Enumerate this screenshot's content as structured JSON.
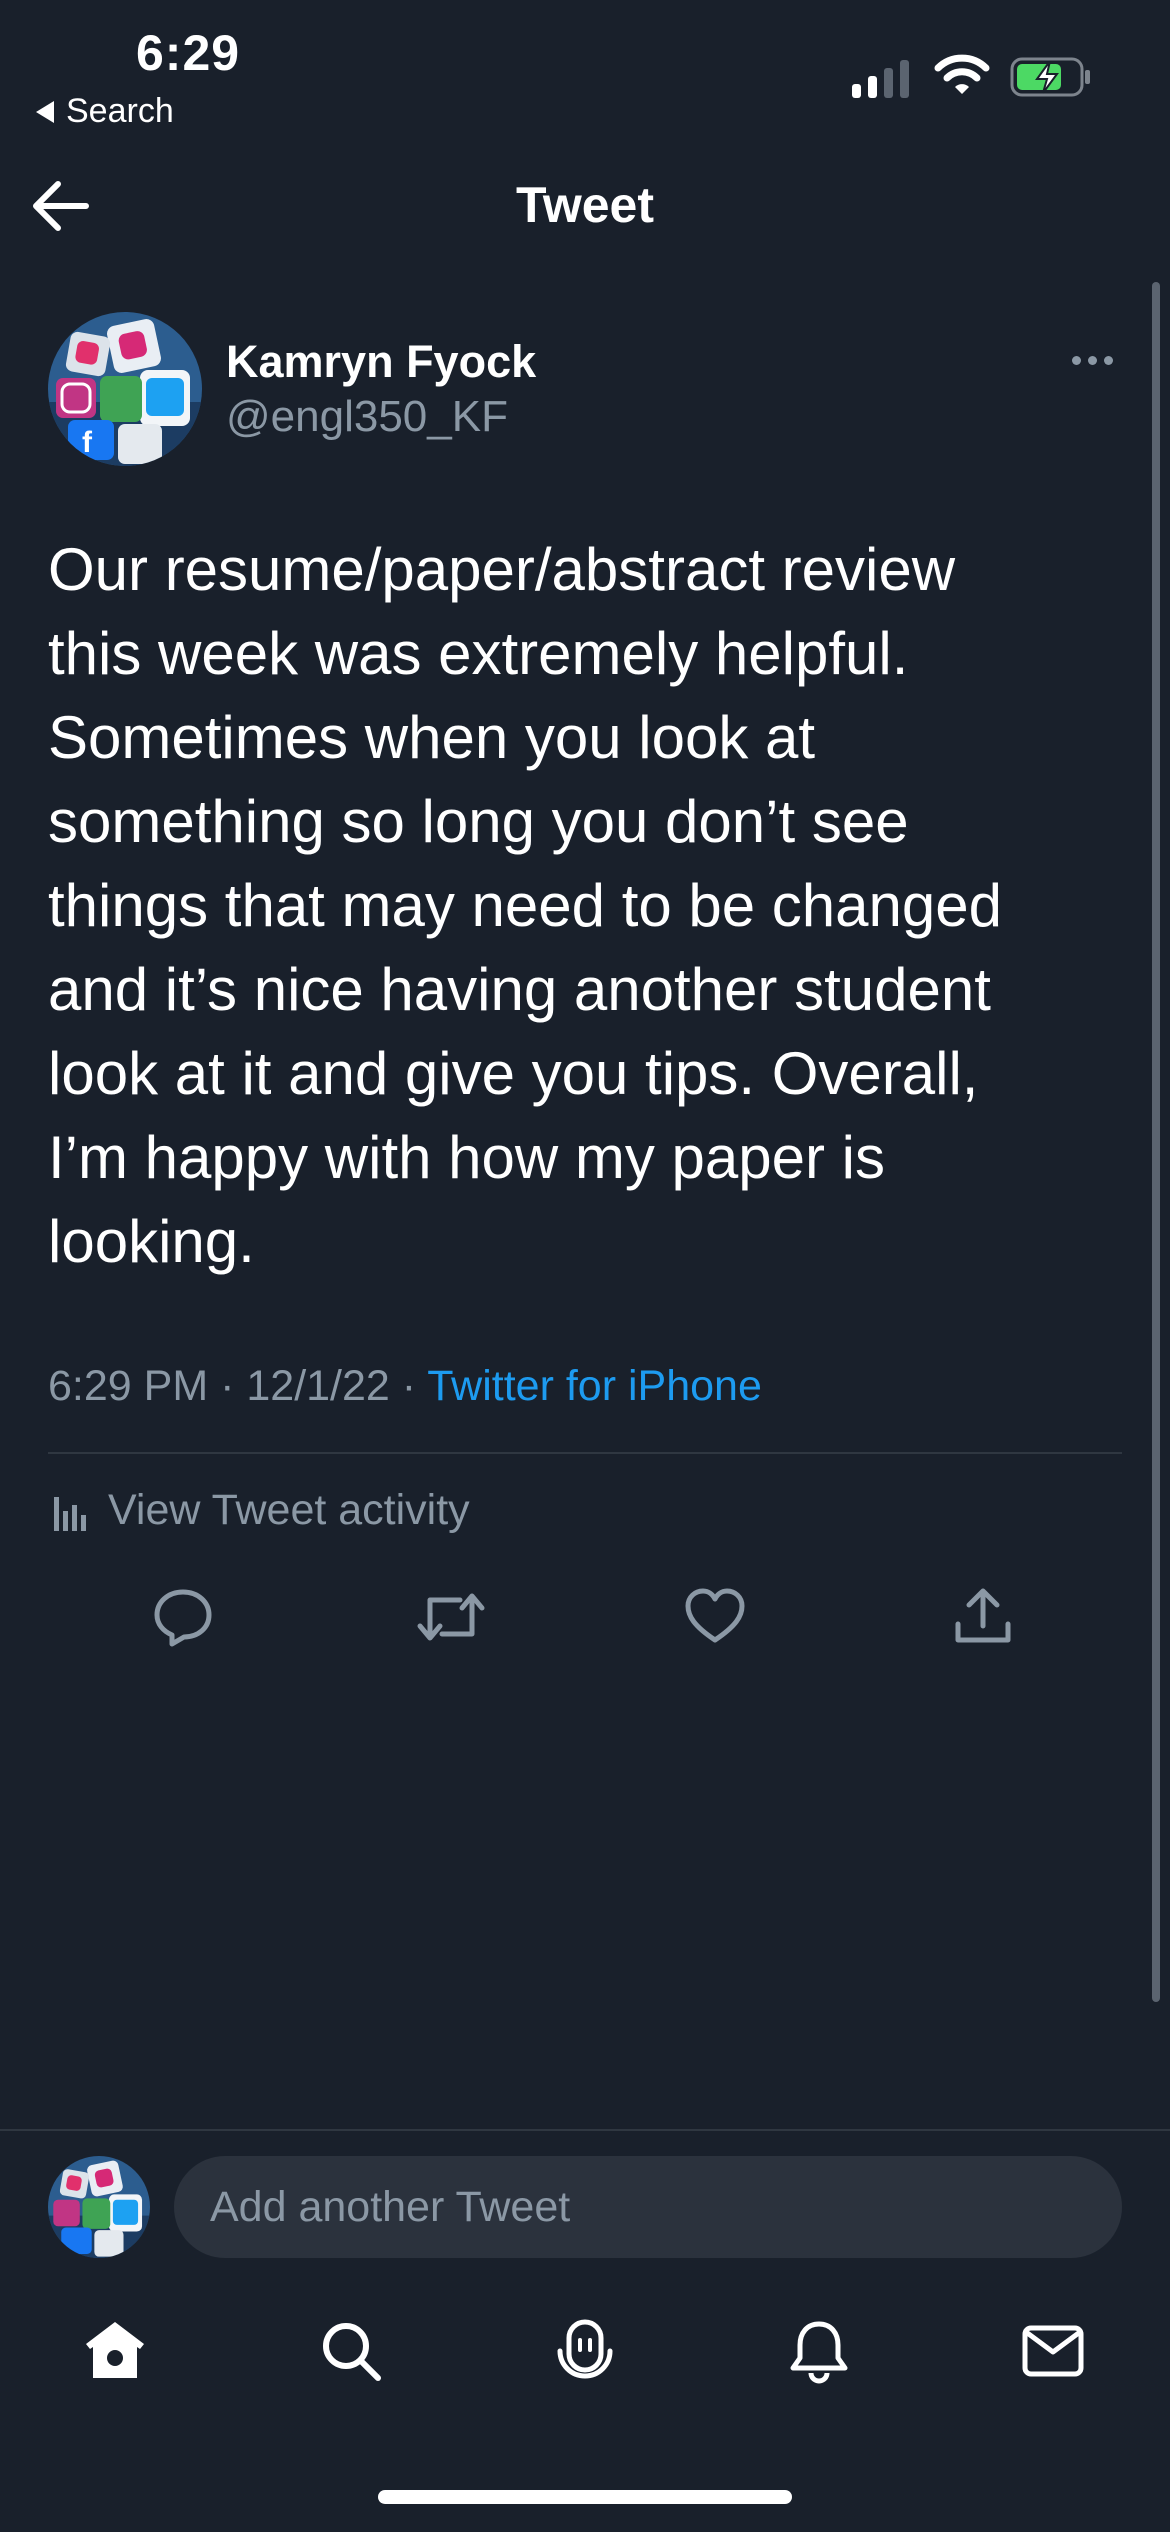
{
  "status_bar": {
    "time": "6:29",
    "back_label": "Search"
  },
  "header": {
    "title": "Tweet"
  },
  "tweet": {
    "author_name": "Kamryn Fyock",
    "author_handle": "@engl350_KF",
    "text": "Our resume/paper/abstract review\nthis week was extremely helpful.\nSometimes when you look at\nsomething so long you don’t see\nthings that may need to be changed\nand it’s nice having another student\nlook at it and give you tips. Overall,\nI’m happy with how my paper is\nlooking.",
    "time": "6:29 PM",
    "date": "12/1/22",
    "separator": " · ",
    "client": "Twitter for iPhone",
    "activity_label": "View Tweet activity"
  },
  "actions": [
    "reply-icon",
    "retweet-icon",
    "like-icon",
    "share-icon"
  ],
  "reply": {
    "placeholder": "Add another Tweet"
  },
  "tab_bar": [
    "home-icon",
    "search-icon",
    "spaces-icon",
    "notifications-icon",
    "messages-icon"
  ],
  "colors": {
    "background": "#19202b",
    "secondary_text": "#8b98a5",
    "link": "#1d9bf0",
    "battery": "#4cd964"
  }
}
